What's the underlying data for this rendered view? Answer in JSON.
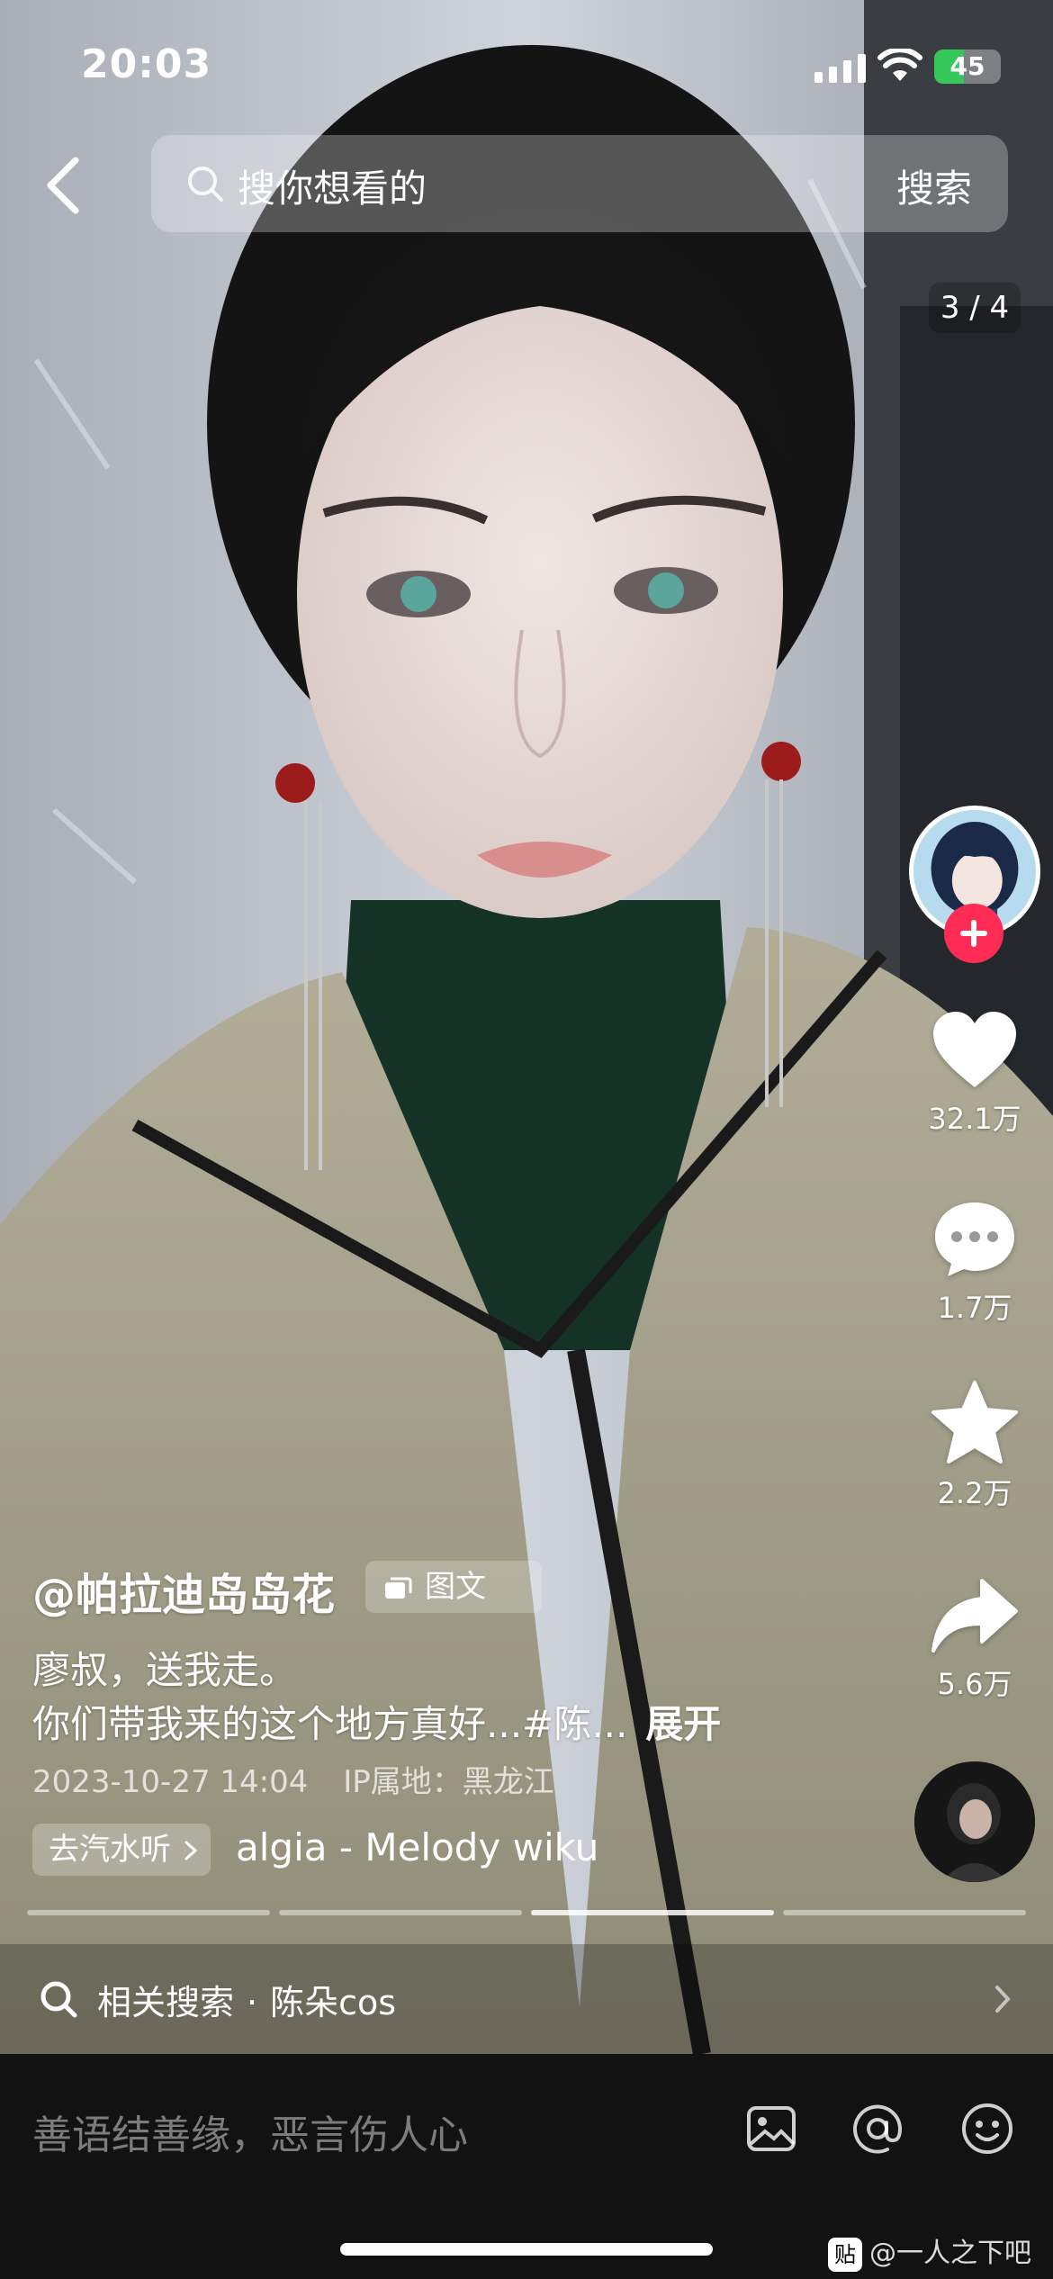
{
  "status_bar": {
    "time": "20:03",
    "battery": "45",
    "battery_level": 0.45,
    "battery_color": "#34c759"
  },
  "search": {
    "back_icon": "chevron-left-icon",
    "placeholder": "搜你想看的",
    "action_label": "搜索"
  },
  "gallery": {
    "page_counter": "3 / 4",
    "current_page": 3,
    "total_pages": 4
  },
  "actions": {
    "follow_icon": "plus-icon",
    "like_count": "32.1万",
    "comment_count": "1.7万",
    "favorite_count": "2.2万",
    "share_count": "5.6万",
    "accent_color": "#fe2c55"
  },
  "post": {
    "author": "@帕拉迪岛岛花",
    "type_badge": "图文",
    "caption_line1": "廖叔，送我走。",
    "caption_line2": "你们带我来的这个地方真好...#陈...",
    "expand_label": "展开",
    "date": "2023-10-27 14:04",
    "ip_location": "IP属地：黑龙江"
  },
  "music": {
    "pill_label": "去汽水听",
    "title": "algia - Melody wiku"
  },
  "related_search": {
    "label": "相关搜索",
    "separator": "·",
    "term": "陈朵cos"
  },
  "comment_bar": {
    "placeholder": "善语结善缘，恶言伤人心"
  },
  "watermark": {
    "logo_text": "贴",
    "text": "@一人之下吧"
  }
}
